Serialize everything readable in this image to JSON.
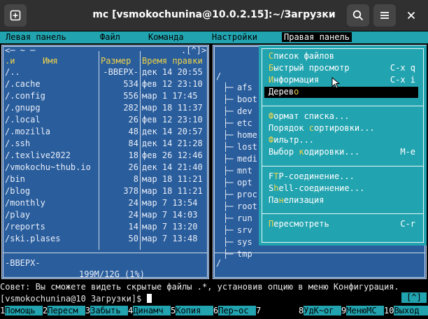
{
  "window": {
    "title": "mc [vsmokochunina@10.0.2.15]:~/Загрузки",
    "new_tab_icon": "plus-square-icon",
    "search_icon": "search-icon",
    "menu_icon": "hamburger-icon",
    "close_icon": "close-icon"
  },
  "menubar": {
    "items": [
      "Левая панель",
      "Файл",
      "Команда",
      "Настройки",
      "Правая панель"
    ]
  },
  "left_panel": {
    "path_top": "<─ ~ ─",
    "path_right": ".[^]>",
    "headers": {
      "sort": ".и",
      "name": "Имя",
      "size": "Размер",
      "time": "Время правки"
    },
    "rows": [
      {
        "name": "/..",
        "size": "-ВВЕРХ-",
        "time": "дек 14 20:55"
      },
      {
        "name": "/.cache",
        "size": "534",
        "time": "фев 12 23:10"
      },
      {
        "name": "/.config",
        "size": "556",
        "time": "мар  1 17:45"
      },
      {
        "name": "/.gnupg",
        "size": "282",
        "time": "мар 18 11:37"
      },
      {
        "name": "/.local",
        "size": "26",
        "time": "фев 12 23:10"
      },
      {
        "name": "/.mozilla",
        "size": "48",
        "time": "дек 14 20:57"
      },
      {
        "name": "/.ssh",
        "size": "84",
        "time": "дек 14 21:28"
      },
      {
        "name": "/.texlive2022",
        "size": "18",
        "time": "фев 26 12:46"
      },
      {
        "name": "/vmokochu~thub.io",
        "size": "26",
        "time": "дек 14 21:40"
      },
      {
        "name": "/bin",
        "size": "8",
        "time": "мар 18 11:21"
      },
      {
        "name": "/blog",
        "size": "378",
        "time": "мар 18 11:21"
      },
      {
        "name": "/monthly",
        "size": "24",
        "time": "мар  7 13:54"
      },
      {
        "name": "/play",
        "size": "24",
        "time": "мар  7 14:03"
      },
      {
        "name": "/reports",
        "size": "14",
        "time": "мар  7 13:20"
      },
      {
        "name": "/ski.plases",
        "size": "50",
        "time": "мар  7 13:48"
      }
    ],
    "footer": "-ВВЕРХ-",
    "disk": "199M/12G (1%)"
  },
  "right_panel": {
    "root": "/",
    "dirs": [
      "afs",
      "boot",
      "dev",
      "etc",
      "home",
      "lost",
      "medi",
      "mnt",
      "opt",
      "proc",
      "root",
      "run",
      "srv",
      "sys",
      "tmp"
    ],
    "footer": "/"
  },
  "popup": {
    "items": [
      {
        "label": "Список файлов",
        "hot": "С",
        "key": ""
      },
      {
        "label": "Быстрый просмотр",
        "hot": "Б",
        "key": "C-x q"
      },
      {
        "label": "Информация",
        "hot": "И",
        "key": "C-x i"
      },
      {
        "label": "Дерево",
        "hot": "о",
        "key": "",
        "selected": true
      },
      {
        "label": "Формат списка...",
        "hot": "Ф",
        "key": ""
      },
      {
        "label": "Порядок сортировки...",
        "hot": "с",
        "key": ""
      },
      {
        "label": "Фильтр...",
        "hot": "Ф",
        "key": ""
      },
      {
        "label": "Выбор кодировки...",
        "hot": "к",
        "key": "M-e"
      },
      {
        "label": "FTP-соединение...",
        "hot": "T",
        "key": ""
      },
      {
        "label": "Shell-соединение...",
        "hot": "h",
        "key": ""
      },
      {
        "label": "Панелизация",
        "hot": "н",
        "key": ""
      },
      {
        "label": "Пересмотреть",
        "hot": "П",
        "key": "C-r"
      }
    ]
  },
  "status": {
    "hint": "Совет: Вы сможете видеть скрытые файлы .*, установив опцию в меню Конфигурация.",
    "prompt": "[vsmokochunina@10 Загрузки]$ ",
    "scroll": "[^]"
  },
  "fkeys": [
    {
      "num": "1",
      "label": "Помощь"
    },
    {
      "num": "2",
      "label": "Пересм"
    },
    {
      "num": "3",
      "label": "Забыть"
    },
    {
      "num": "4",
      "label": "Динамч"
    },
    {
      "num": "5",
      "label": "Копия"
    },
    {
      "num": "6",
      "label": "Пер~ос"
    },
    {
      "num": "7",
      "label": ""
    },
    {
      "num": "8",
      "label": "УдК~ог"
    },
    {
      "num": "9",
      "label": "МенюМС"
    },
    {
      "num": "10",
      "label": "Выход"
    }
  ]
}
